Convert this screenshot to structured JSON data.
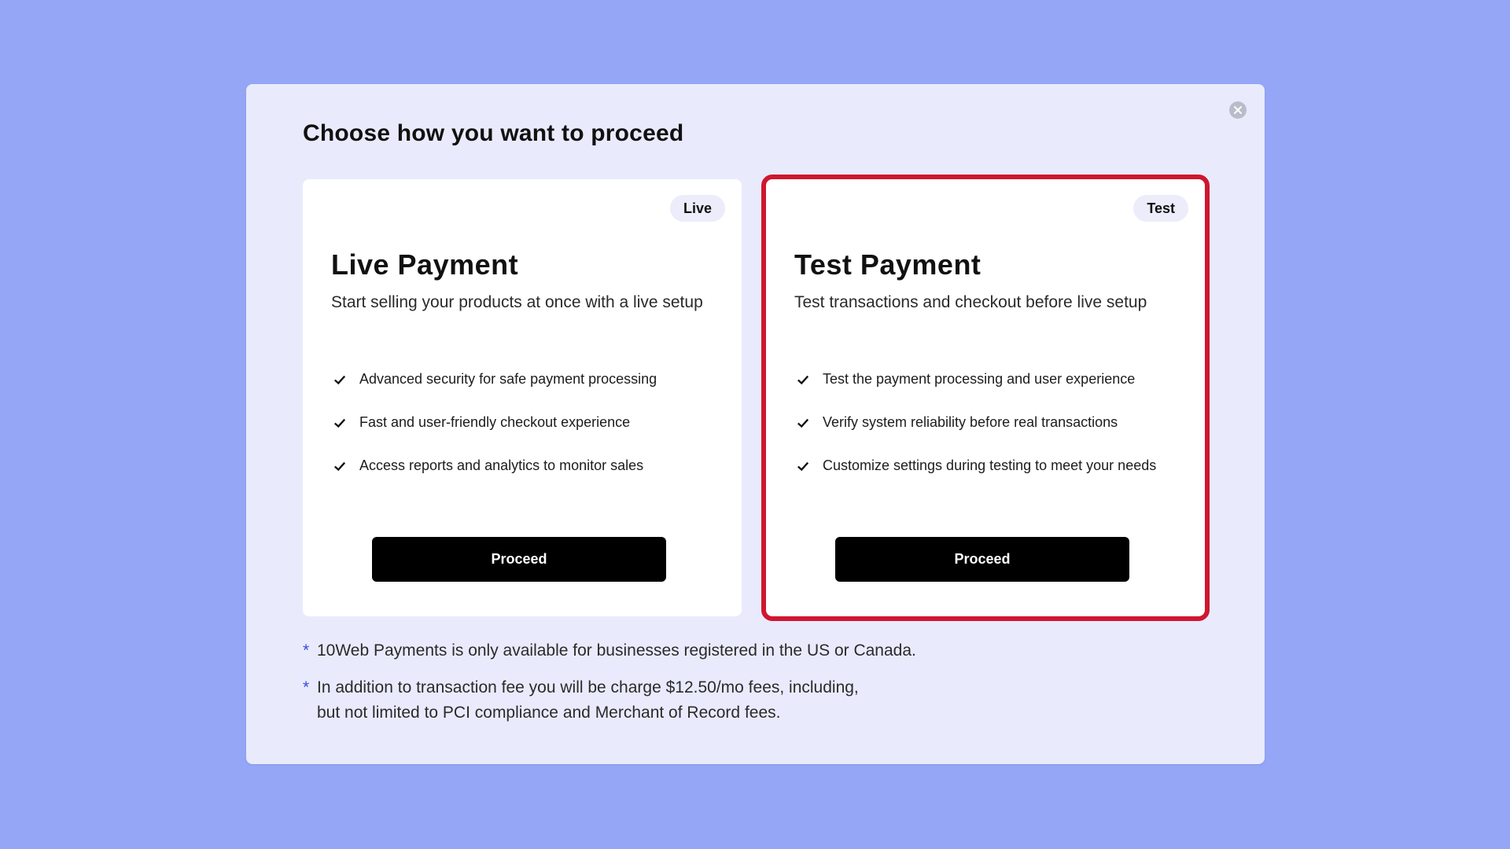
{
  "modal": {
    "title": "Choose how you want to proceed",
    "close_icon": "close-icon"
  },
  "cards": {
    "live": {
      "badge": "Live",
      "title": "Live Payment",
      "subtitle": "Start selling your products at once with a live setup",
      "features": [
        "Advanced security for safe payment processing",
        "Fast and user-friendly checkout experience",
        "Access reports and analytics to monitor sales"
      ],
      "button_label": "Proceed"
    },
    "test": {
      "badge": "Test",
      "title": "Test Payment",
      "subtitle": "Test transactions and checkout before live setup",
      "features": [
        "Test the payment processing and user experience",
        "Verify system reliability before real transactions",
        "Customize settings during testing to meet your needs"
      ],
      "button_label": "Proceed",
      "highlighted": true
    }
  },
  "notes": [
    {
      "marker": "*",
      "line1": "10Web Payments is only available for businesses registered in the US or Canada."
    },
    {
      "marker": "*",
      "line1": "In addition to transaction fee you will be charge $12.50/mo fees, including,",
      "line2": "but not limited to PCI compliance and Merchant of Record fees."
    }
  ],
  "colors": {
    "background": "#96a6f7",
    "modal_bg": "#e9ebfd",
    "highlight_border": "#d0162f",
    "note_marker": "#3b4bd8",
    "button_bg": "#000000"
  }
}
